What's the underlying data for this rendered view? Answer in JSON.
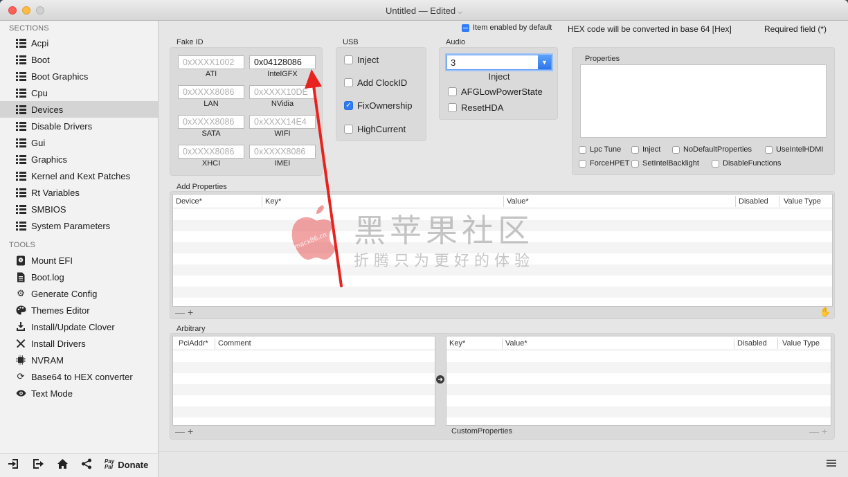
{
  "window": {
    "title": "Untitled",
    "status": "— Edited"
  },
  "sidebar": {
    "sections_header": "SECTIONS",
    "sections": [
      {
        "label": "Acpi",
        "selected": false
      },
      {
        "label": "Boot",
        "selected": false
      },
      {
        "label": "Boot Graphics",
        "selected": false
      },
      {
        "label": "Cpu",
        "selected": false
      },
      {
        "label": "Devices",
        "selected": true
      },
      {
        "label": "Disable Drivers",
        "selected": false
      },
      {
        "label": "Gui",
        "selected": false
      },
      {
        "label": "Graphics",
        "selected": false
      },
      {
        "label": "Kernel and Kext Patches",
        "selected": false
      },
      {
        "label": "Rt Variables",
        "selected": false
      },
      {
        "label": "SMBIOS",
        "selected": false
      },
      {
        "label": "System Parameters",
        "selected": false
      }
    ],
    "tools_header": "TOOLS",
    "tools": [
      {
        "label": "Mount EFI",
        "icon": "disk-icon"
      },
      {
        "label": "Boot.log",
        "icon": "document-icon"
      },
      {
        "label": "Generate Config",
        "icon": "gears-icon"
      },
      {
        "label": "Themes Editor",
        "icon": "palette-icon"
      },
      {
        "label": "Install/Update Clover",
        "icon": "download-icon"
      },
      {
        "label": "Install Drivers",
        "icon": "wrench-icon"
      },
      {
        "label": "NVRAM",
        "icon": "chip-icon"
      },
      {
        "label": "Base64 to HEX converter",
        "icon": "refresh-icon"
      },
      {
        "label": "Text Mode",
        "icon": "eye-icon"
      }
    ],
    "bottom": {
      "paypal_top": "Pay",
      "paypal_bottom": "Pal",
      "donate": "Donate"
    }
  },
  "topbar": {
    "item_enabled": "Item enabled by default",
    "hex_note": "HEX code will be converted in base 64 [Hex]",
    "required": "Required field (*)"
  },
  "fake_id": {
    "title": "Fake ID",
    "fields": [
      {
        "caption": "ATI",
        "value": "0xXXXX1002",
        "active": false
      },
      {
        "caption": "IntelGFX",
        "value": "0x04128086",
        "active": true
      },
      {
        "caption": "LAN",
        "value": "0xXXXX8086",
        "active": false
      },
      {
        "caption": "NVidia",
        "value": "0xXXXX10DE",
        "active": false
      },
      {
        "caption": "SATA",
        "value": "0xXXXX8086",
        "active": false
      },
      {
        "caption": "WIFI",
        "value": "0xXXXX14E4",
        "active": false
      },
      {
        "caption": "XHCI",
        "value": "0xXXXX8086",
        "active": false
      },
      {
        "caption": "IMEI",
        "value": "0xXXXX8086",
        "active": false
      }
    ]
  },
  "usb": {
    "title": "USB",
    "options": [
      {
        "label": "Inject",
        "checked": false
      },
      {
        "label": "Add ClockID",
        "checked": false
      },
      {
        "label": "FixOwnership",
        "checked": true
      },
      {
        "label": "HighCurrent",
        "checked": false
      }
    ]
  },
  "audio": {
    "title": "Audio",
    "select_value": "3",
    "select_caption": "Inject",
    "options": [
      {
        "label": "AFGLowPowerState",
        "checked": false
      },
      {
        "label": "ResetHDA",
        "checked": false
      }
    ]
  },
  "properties": {
    "title": "Properties",
    "options": [
      {
        "label": "Lpc Tune",
        "checked": false
      },
      {
        "label": "Inject",
        "checked": false
      },
      {
        "label": "NoDefaultProperties",
        "checked": false
      },
      {
        "label": "UseIntelHDMI",
        "checked": false
      },
      {
        "label": "ForceHPET",
        "checked": false
      },
      {
        "label": "SetIntelBacklight",
        "checked": false
      },
      {
        "label": "DisableFunctions",
        "checked": false
      }
    ]
  },
  "add_properties": {
    "title": "Add Properties",
    "columns": [
      "Device*",
      "Key*",
      "Value*",
      "Disabled",
      "Value Type"
    ],
    "controls": {
      "remove": "—",
      "add": "+"
    }
  },
  "arbitrary": {
    "title": "Arbitrary",
    "left_columns": [
      "PciAddr*",
      "Comment"
    ],
    "right_columns": [
      "Key*",
      "Value*",
      "Disabled",
      "Value Type"
    ],
    "custom_label": "CustomProperties",
    "controls": {
      "remove": "—",
      "add": "+"
    }
  },
  "watermark": {
    "brand": "macx86.cn",
    "main": "黑苹果社区",
    "sub": "折腾只为更好的体验"
  },
  "colors": {
    "accent": "#2f7cf6",
    "arrow": "#e8231f",
    "selection": "#d4d4d4"
  }
}
